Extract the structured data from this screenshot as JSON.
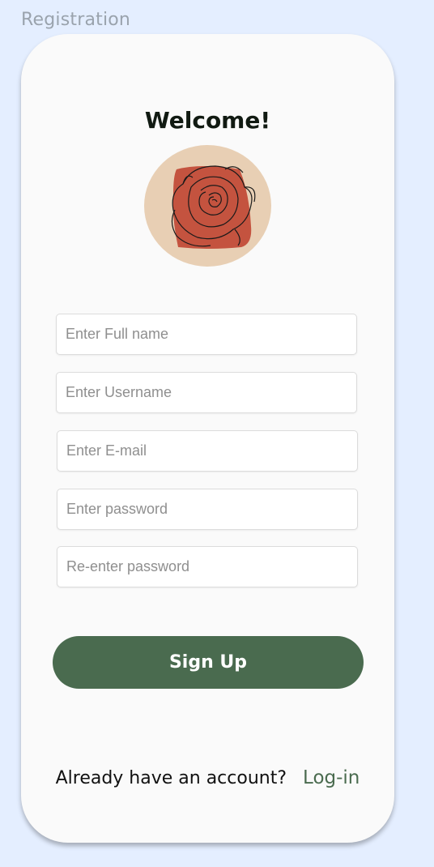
{
  "frame": {
    "label": "Registration"
  },
  "card": {
    "title": "Welcome!",
    "avatar_icon": "rose-illustration-icon",
    "fields": [
      {
        "name": "full-name",
        "placeholder": "Enter Full name",
        "value": ""
      },
      {
        "name": "username",
        "placeholder": "Enter Username",
        "value": ""
      },
      {
        "name": "email",
        "placeholder": "Enter E-mail",
        "value": ""
      },
      {
        "name": "password",
        "placeholder": "Enter password",
        "value": ""
      },
      {
        "name": "confirm-password",
        "placeholder": "Re-enter password",
        "value": ""
      }
    ],
    "signup_label": "Sign Up",
    "footer_question": "Already have an account?",
    "login_label": "Log-in"
  },
  "colors": {
    "background": "#e4eeff",
    "card": "#fafafa",
    "accent_green": "#4a6b4f",
    "avatar_bg": "#e8cfb4",
    "rose": "#c4533f"
  }
}
